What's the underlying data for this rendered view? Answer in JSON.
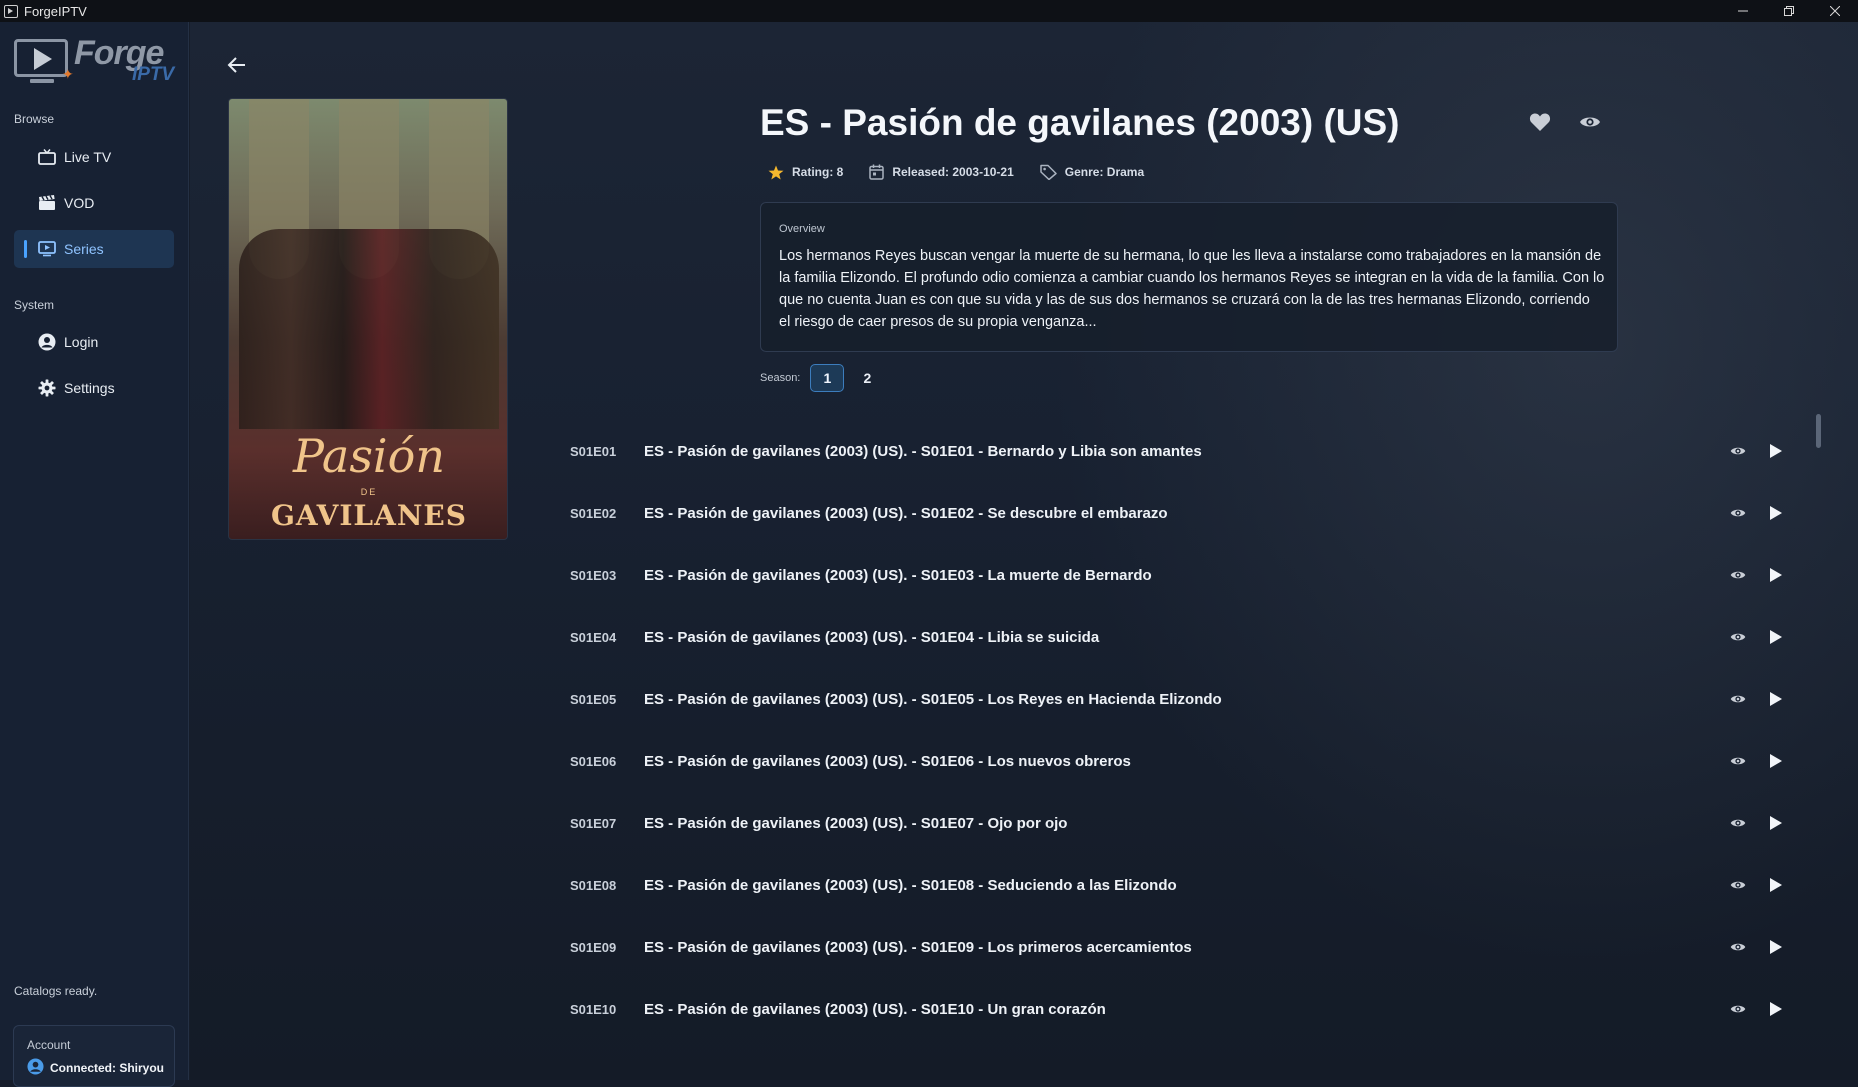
{
  "window": {
    "title": "ForgeIPTV"
  },
  "logo": {
    "forge": "Forge",
    "iptv": "IPTV"
  },
  "sidebar": {
    "browse_label": "Browse",
    "system_label": "System",
    "items": [
      {
        "label": "Live TV",
        "icon": "tv-icon"
      },
      {
        "label": "VOD",
        "icon": "clapperboard-icon"
      },
      {
        "label": "Series",
        "icon": "series-icon",
        "active": true
      },
      {
        "label": "Login",
        "icon": "user-circle-icon"
      },
      {
        "label": "Settings",
        "icon": "gear-icon"
      }
    ],
    "catalog_status": "Catalogs ready.",
    "account": {
      "label": "Account",
      "status": "Connected: Shiryou"
    }
  },
  "series": {
    "title": "ES - Pasión de gavilanes (2003) (US)",
    "rating": "Rating: 8",
    "released": "Released: 2003-10-21",
    "genre": "Genre: Drama",
    "overview_label": "Overview",
    "overview": "Los hermanos Reyes buscan vengar la muerte de su hermana, lo que les lleva a instalarse como trabajadores en la mansión de la familia Elizondo. El profundo odio comienza a cambiar cuando los hermanos Reyes se integran en la vida de la familia. Con lo que no cuenta Juan es con que su vida y las de sus dos hermanos se cruzará con la de las tres hermanas Elizondo, corriendo el riesgo de caer presos de su propia venganza...",
    "poster": {
      "line1": "Pasión",
      "line2": "DE",
      "line3": "GAVILANES"
    }
  },
  "season": {
    "label": "Season:",
    "options": [
      "1",
      "2"
    ],
    "selected": "1"
  },
  "episodes": [
    {
      "code": "S01E01",
      "title": "ES - Pasión de gavilanes (2003) (US). - S01E01 - Bernardo y Libia son amantes"
    },
    {
      "code": "S01E02",
      "title": "ES - Pasión de gavilanes (2003) (US). - S01E02 - Se descubre el embarazo"
    },
    {
      "code": "S01E03",
      "title": "ES - Pasión de gavilanes (2003) (US). - S01E03 - La muerte de Bernardo"
    },
    {
      "code": "S01E04",
      "title": "ES - Pasión de gavilanes (2003) (US). - S01E04 - Libia se suicida"
    },
    {
      "code": "S01E05",
      "title": "ES - Pasión de gavilanes (2003) (US). - S01E05 - Los Reyes en Hacienda Elizondo"
    },
    {
      "code": "S01E06",
      "title": "ES - Pasión de gavilanes (2003) (US). - S01E06 - Los nuevos obreros"
    },
    {
      "code": "S01E07",
      "title": "ES - Pasión de gavilanes (2003) (US). - S01E07 - Ojo por ojo"
    },
    {
      "code": "S01E08",
      "title": "ES - Pasión de gavilanes (2003) (US). - S01E08 - Seduciendo a las Elizondo"
    },
    {
      "code": "S01E09",
      "title": "ES - Pasión de gavilanes (2003) (US). - S01E09 - Los primeros acercamientos"
    },
    {
      "code": "S01E10",
      "title": "ES - Pasión de gavilanes (2003) (US). - S01E10 - Un gran corazón"
    }
  ],
  "colors": {
    "accent": "#4aa3ff",
    "sidebar_bg": "#172133",
    "main_bg": "#182131",
    "star": "#f5b82e"
  }
}
